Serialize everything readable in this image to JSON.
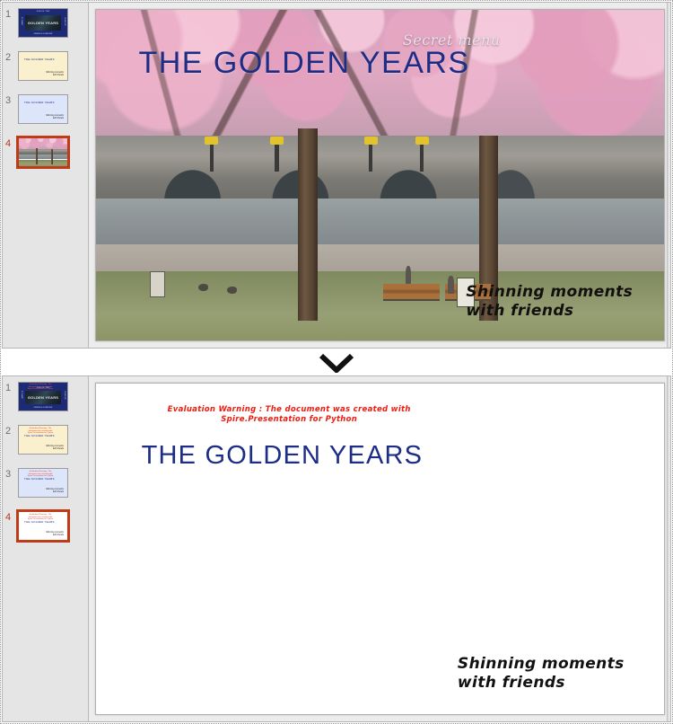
{
  "app": {
    "selected_slide_number": 4,
    "divider_icon": "chevron-down-icon",
    "accent_selection_color": "#bf3b18",
    "title_color": "#1d2d86",
    "warning_color": "#f01c10"
  },
  "panels": {
    "top": {
      "name": "original-presentation-panel",
      "slide": {
        "title": "THE GOLDEN YEARS",
        "script_label": "Secret menu",
        "signature_line1": "Shinning moments",
        "signature_line2": "with friends",
        "background": "cherry-blossom-bridge-photo"
      }
    },
    "bottom": {
      "name": "converted-presentation-panel",
      "slide": {
        "evaluation_warning_line1": "Evaluation Warning : The document was created with",
        "evaluation_warning_line2": "Spire.Presentation for Python",
        "title": "THE GOLDEN YEARS",
        "signature_line1": "Shinning moments",
        "signature_line2": "with friends"
      }
    }
  },
  "thumbnails_top": [
    {
      "number": "1",
      "style": "dark",
      "selected": false,
      "top_text": "SCHOOL TRIP",
      "center_text": "GOLDEN YEARS",
      "left_text": "BY NAME",
      "right_text": "CLASS OF",
      "bottom_text": "FRIENDS FOREVER"
    },
    {
      "number": "2",
      "style": "cream",
      "selected": false,
      "title": "THE GOLDEN YEARS",
      "sign1": "Shinning moments",
      "sign2": "with friends"
    },
    {
      "number": "3",
      "style": "blue",
      "selected": false,
      "title": "THE GOLDEN YEARS",
      "sign1": "Shinning moments",
      "sign2": "with friends"
    },
    {
      "number": "4",
      "style": "photo",
      "selected": true,
      "title": "",
      "sign1": "",
      "sign2": ""
    }
  ],
  "thumbnails_bottom": [
    {
      "number": "1",
      "style": "dark",
      "selected": false,
      "warning": "Evaluation Warning : The document was created with Spire.Presentation for Python",
      "top_text": "SCHOOL TRIP",
      "center_text": "GOLDEN YEARS",
      "left_text": "BY NAME",
      "right_text": "CLASS OF",
      "bottom_text": "FRIENDS FOREVER"
    },
    {
      "number": "2",
      "style": "cream",
      "selected": false,
      "warning": "Evaluation Warning : The document was created with Spire.Presentation for Python",
      "title": "THE GOLDEN YEARS",
      "sign1": "Shinning moments",
      "sign2": "with friends"
    },
    {
      "number": "3",
      "style": "blue",
      "selected": false,
      "warning": "Evaluation Warning : The document was created with Spire.Presentation for Python",
      "title": "THE GOLDEN YEARS",
      "sign1": "Shinning moments",
      "sign2": "with friends"
    },
    {
      "number": "4",
      "style": "white",
      "selected": true,
      "warning": "Evaluation Warning : The document was created with Spire.Presentation for Python",
      "title": "THE GOLDEN YEARS",
      "sign1": "Shinning moments",
      "sign2": "with friends"
    }
  ]
}
